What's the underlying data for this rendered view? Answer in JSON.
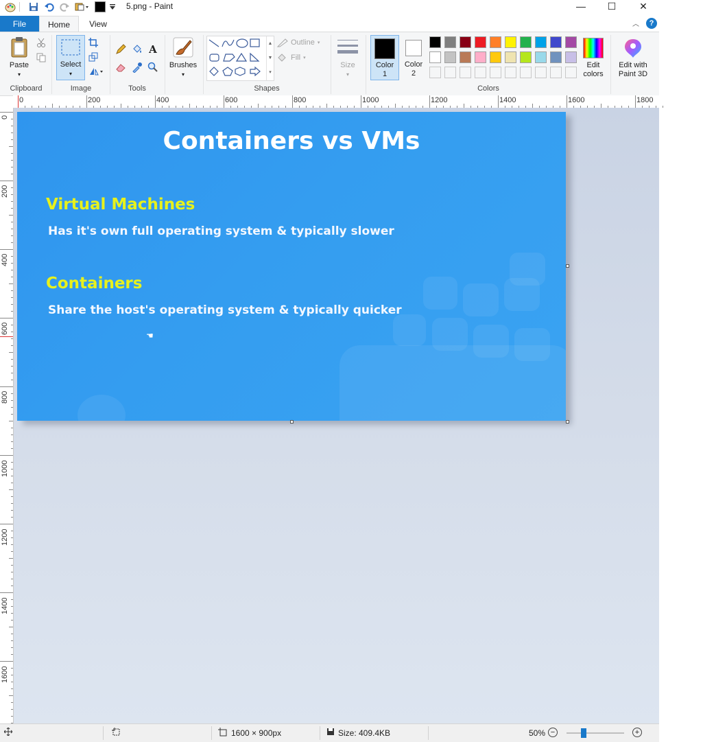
{
  "window": {
    "title": "5.png - Paint",
    "minimize": "—",
    "maximize": "☐",
    "close": "✕"
  },
  "tabs": {
    "file": "File",
    "home": "Home",
    "view": "View"
  },
  "ribbon": {
    "clipboard": {
      "paste": "Paste",
      "group": "Clipboard"
    },
    "image": {
      "select": "Select",
      "group": "Image"
    },
    "tools": {
      "group": "Tools"
    },
    "brushes": {
      "label": "Brushes"
    },
    "shapes": {
      "outline": "Outline",
      "fill": "Fill",
      "group": "Shapes"
    },
    "size": {
      "label": "Size"
    },
    "color1": {
      "label": "Color",
      "num": "1",
      "value": "#000000"
    },
    "color2": {
      "label": "Color",
      "num": "2",
      "value": "#ffffff"
    },
    "colors": {
      "group": "Colors",
      "row1": [
        "#000000",
        "#7f7f7f",
        "#880015",
        "#ed1c24",
        "#ff7f27",
        "#fff200",
        "#22b14c",
        "#00a2e8",
        "#3f48cc",
        "#a349a4"
      ],
      "row2": [
        "#ffffff",
        "#c3c3c3",
        "#b97a57",
        "#ffaec9",
        "#ffc90e",
        "#efe4b0",
        "#b5e61d",
        "#99d9ea",
        "#7092be",
        "#c8bfe7"
      ]
    },
    "edit_colors": {
      "line1": "Edit",
      "line2": "colors"
    },
    "paint3d": {
      "line1": "Edit with",
      "line2": "Paint 3D"
    }
  },
  "ruler": {
    "h": [
      "0",
      "200",
      "400",
      "600",
      "800",
      "1000",
      "1200",
      "1400",
      "1600",
      "1800"
    ],
    "v": [
      "0",
      "200",
      "400",
      "600",
      "800",
      "1000",
      "1200",
      "1400",
      "1600"
    ]
  },
  "slide": {
    "title": "Containers vs VMs",
    "vm_heading": "Virtual Machines",
    "vm_text": "Has it's own full operating system & typically slower",
    "ct_heading": "Containers",
    "ct_text": "Share the host's operating system & typically quicker"
  },
  "status": {
    "dimensions": "1600 × 900px",
    "size": "Size: 409.4KB",
    "zoom": "50%",
    "zoom_level": 0.5
  }
}
